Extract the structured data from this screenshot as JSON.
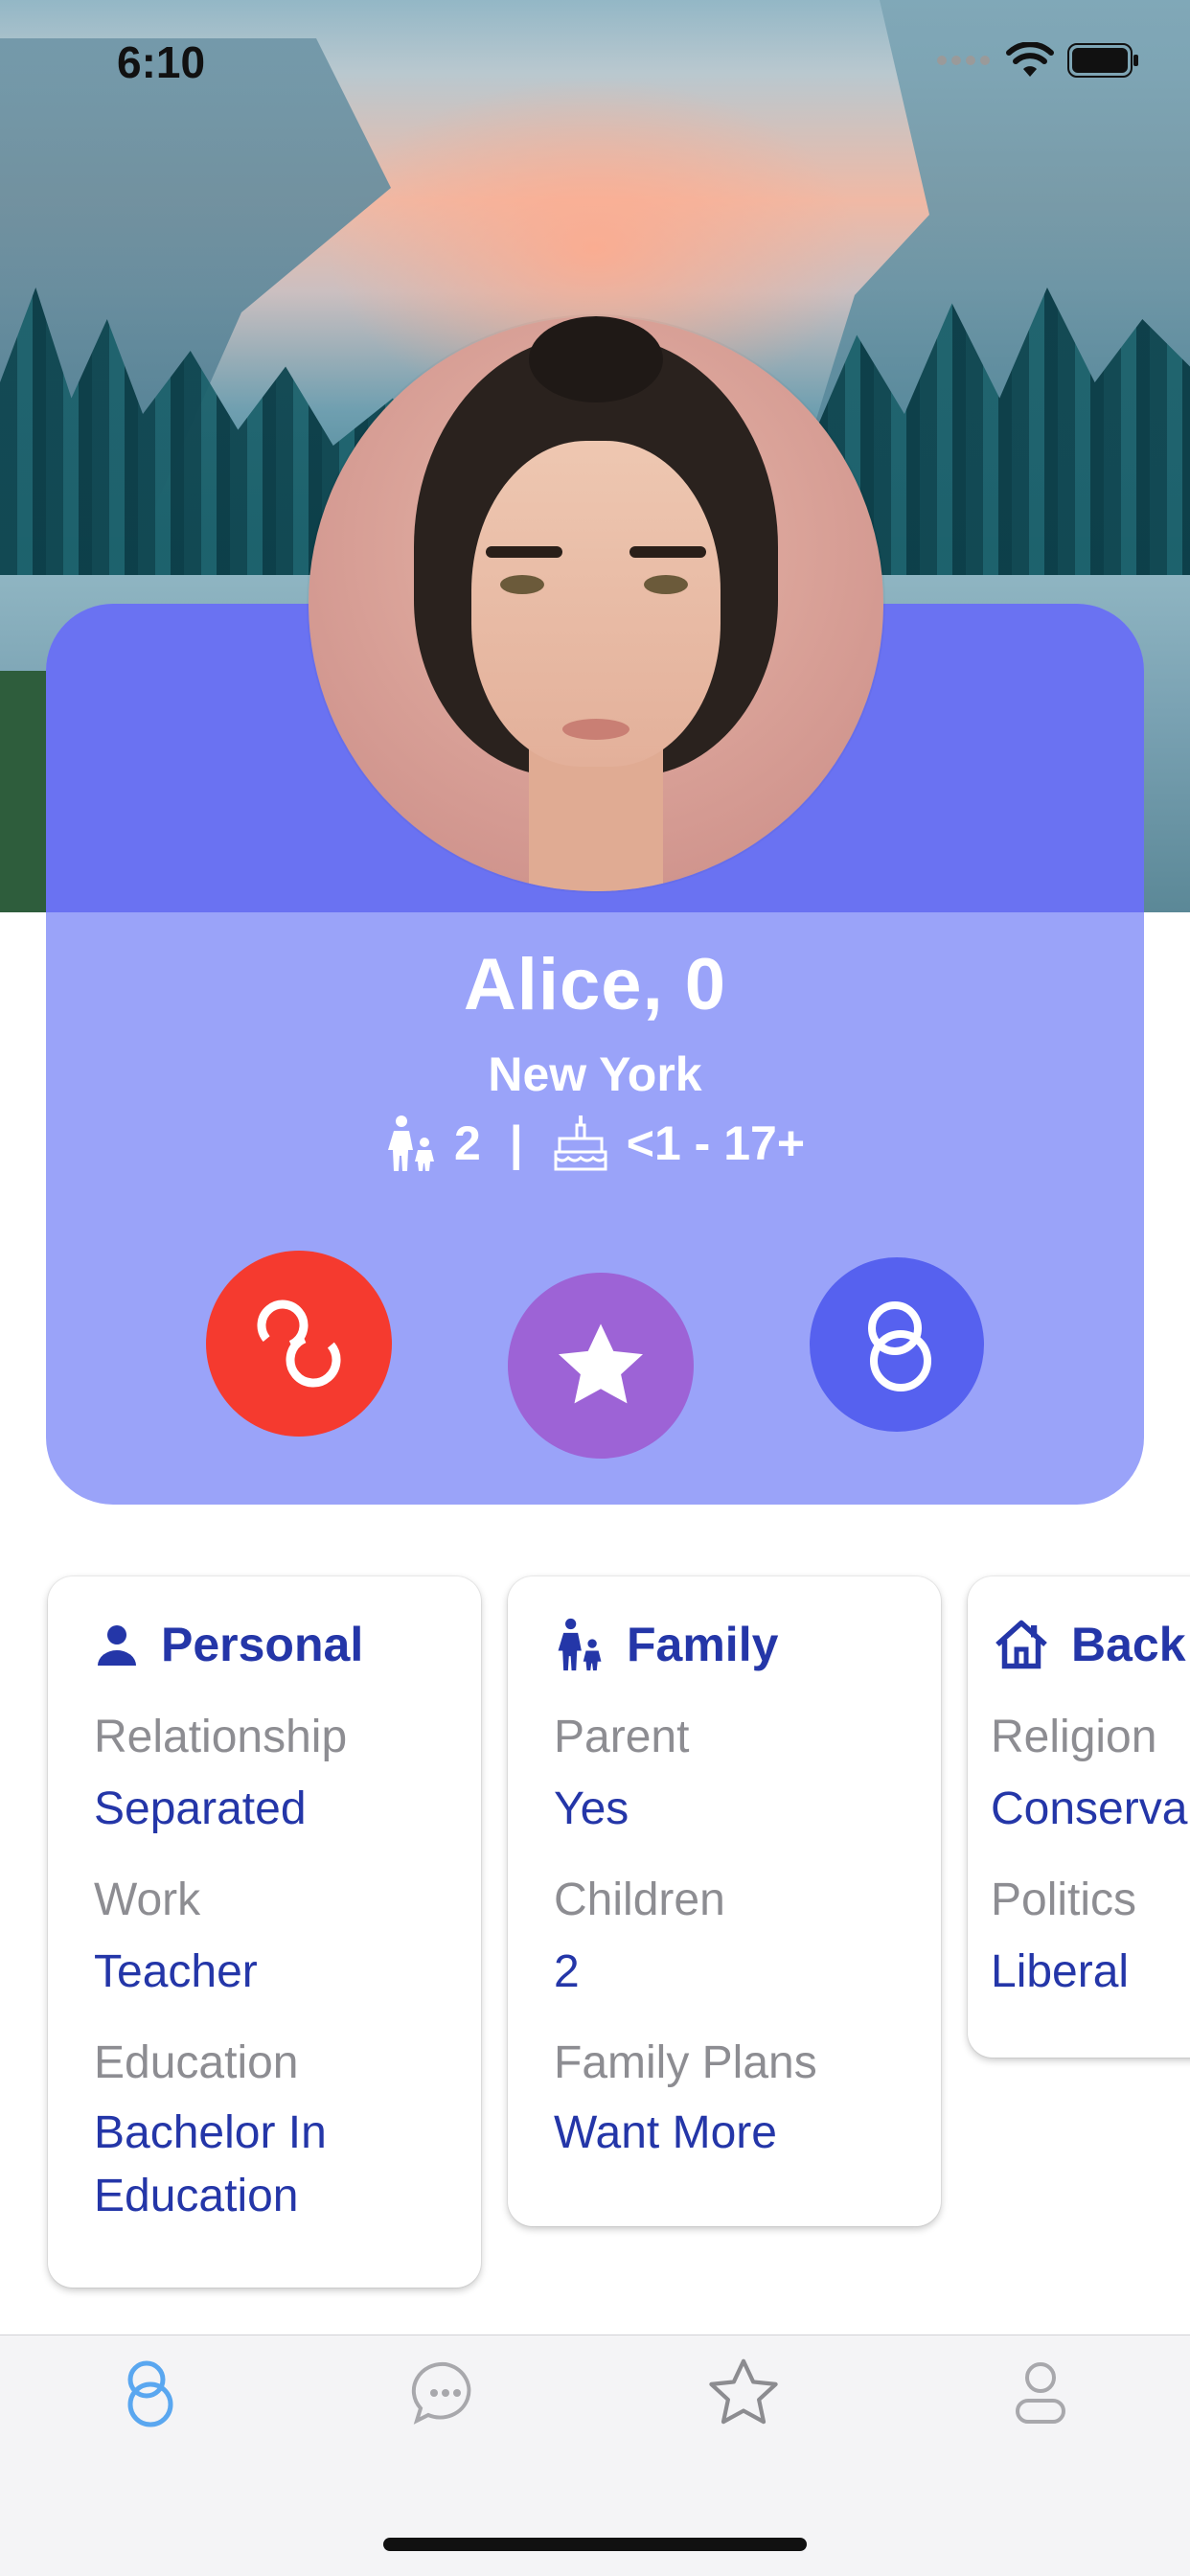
{
  "status_bar": {
    "time": "6:10"
  },
  "profile": {
    "name_age": "Alice, 0",
    "location": "New York",
    "children_count": "2",
    "separator": "|",
    "children_ages": "<1 - 17+"
  },
  "colors": {
    "accent": "#2436a8",
    "card": "#9aa3f9",
    "pass": "#f53a2f",
    "star": "#9d63d6",
    "like": "#5661ef"
  },
  "info_cards": {
    "personal": {
      "title": "Personal",
      "icon": "person-icon",
      "rows": [
        {
          "label": "Relationship",
          "value": "Separated"
        },
        {
          "label": "Work",
          "value": "Teacher"
        },
        {
          "label": "Education",
          "value": "Bachelor In Education"
        }
      ]
    },
    "family": {
      "title": "Family",
      "icon": "family-icon",
      "rows": [
        {
          "label": "Parent",
          "value": "Yes"
        },
        {
          "label": "Children",
          "value": "2"
        },
        {
          "label": "Family Plans",
          "value": "Want More"
        }
      ]
    },
    "background": {
      "title": "Back",
      "icon": "house-icon",
      "rows": [
        {
          "label": "Religion",
          "value": "Conserva"
        },
        {
          "label": "Politics",
          "value": "Liberal"
        }
      ]
    }
  },
  "tab_bar": {
    "tabs": [
      {
        "icon": "rings-icon",
        "active": true
      },
      {
        "icon": "chat-bubble-icon",
        "active": false
      },
      {
        "icon": "star-icon",
        "active": false
      },
      {
        "icon": "profile-icon",
        "active": false
      }
    ]
  }
}
